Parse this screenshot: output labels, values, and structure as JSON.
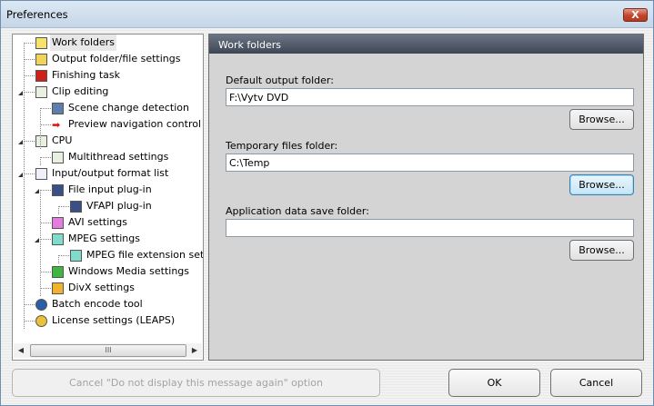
{
  "window": {
    "title": "Preferences",
    "close": "X"
  },
  "tree": {
    "items": [
      {
        "label": "Work folders",
        "icon": "folder-icon",
        "level": 0,
        "selected": true
      },
      {
        "label": "Output folder/file settings",
        "icon": "folder-file-icon",
        "level": 0
      },
      {
        "label": "Finishing task",
        "icon": "power-icon",
        "level": 0
      },
      {
        "label": "Clip editing",
        "icon": "edit-icon",
        "level": 0,
        "expanded": true
      },
      {
        "label": "Scene change detection",
        "icon": "film-icon",
        "level": 1
      },
      {
        "label": "Preview navigation control",
        "icon": "red-arrow-icon",
        "level": 1
      },
      {
        "label": "CPU",
        "icon": "edit-icon",
        "level": 0,
        "expanded": true
      },
      {
        "label": "Multithread settings",
        "icon": "edit-icon",
        "level": 1
      },
      {
        "label": "Input/output format list",
        "icon": "list-icon",
        "level": 0,
        "expanded": true
      },
      {
        "label": "File input plug-in",
        "icon": "plugin-icon",
        "level": 1,
        "expanded": true
      },
      {
        "label": "VFAPI plug-in",
        "icon": "plugin-icon",
        "level": 2
      },
      {
        "label": "AVI settings",
        "icon": "avi-file-icon",
        "level": 1
      },
      {
        "label": "MPEG settings",
        "icon": "mpeg-file-icon",
        "level": 1,
        "expanded": true
      },
      {
        "label": "MPEG file extension settings",
        "icon": "mpeg-file-icon",
        "level": 2
      },
      {
        "label": "Windows Media settings",
        "icon": "wm-file-icon",
        "level": 1
      },
      {
        "label": "DivX settings",
        "icon": "divx-file-icon",
        "level": 1
      },
      {
        "label": "Batch encode tool",
        "icon": "clock-icon",
        "level": 0
      },
      {
        "label": "License settings (LEAPS)",
        "icon": "key-icon",
        "level": 0
      }
    ],
    "scroll_grip": "III"
  },
  "panel": {
    "title": "Work folders",
    "fields": [
      {
        "label": "Default output folder:",
        "value": "F:\\Vytv DVD",
        "browse": "Browse..."
      },
      {
        "label": "Temporary files folder:",
        "value": "C:\\Temp",
        "browse": "Browse..."
      },
      {
        "label": "Application data save folder:",
        "value": "",
        "browse": "Browse..."
      }
    ]
  },
  "footer": {
    "cancel_message": "Cancel \"Do not display this message again\" option",
    "ok": "OK",
    "cancel": "Cancel"
  }
}
